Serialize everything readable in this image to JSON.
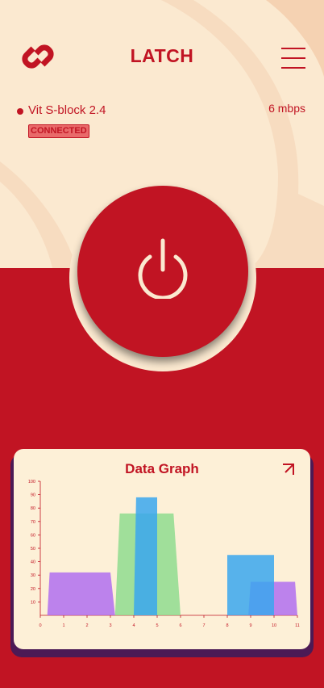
{
  "header": {
    "brand": "LATCH",
    "logo_icon": "chain-link-icon",
    "menu_icon": "hamburger-menu-icon"
  },
  "connection": {
    "network_name": "Vit S-block 2.4",
    "speed": "6 mbps",
    "status": "CONNECTED"
  },
  "power": {
    "icon": "power-icon"
  },
  "graph_card": {
    "title": "Data Graph",
    "expand_icon": "expand-arrow-icon"
  },
  "colors": {
    "primary": "#c11423",
    "cream": "#fbe9d0",
    "purple": "#b06ef0",
    "green": "#8fdc8f",
    "blue": "#3aa7ee"
  },
  "chart_data": {
    "type": "area",
    "xlim": [
      0,
      11
    ],
    "ylim": [
      0,
      100
    ],
    "xticks": [
      "0",
      "1",
      "2",
      "3",
      "4",
      "5",
      "6",
      "7",
      "8",
      "9",
      "10",
      "11"
    ],
    "yticks": [
      "10",
      "20",
      "30",
      "40",
      "50",
      "60",
      "70",
      "80",
      "90",
      "100"
    ],
    "series": [
      {
        "color": "#b06ef0",
        "points": [
          [
            0.3,
            0
          ],
          [
            0.4,
            32
          ],
          [
            3,
            32
          ],
          [
            3.2,
            0
          ]
        ]
      },
      {
        "color": "#b06ef0",
        "points": [
          [
            8.9,
            0
          ],
          [
            9,
            25
          ],
          [
            9.9,
            25
          ],
          [
            10.9,
            25
          ],
          [
            11,
            0
          ]
        ]
      },
      {
        "color": "#8fdc8f",
        "points": [
          [
            3.2,
            0
          ],
          [
            3.4,
            76
          ],
          [
            5.7,
            76
          ],
          [
            6,
            0
          ]
        ]
      },
      {
        "color": "#3aa7ee",
        "points": [
          [
            4,
            0
          ],
          [
            4.1,
            88
          ],
          [
            5,
            88
          ],
          [
            5,
            0
          ]
        ]
      },
      {
        "color": "#3aa7ee",
        "points": [
          [
            8,
            0
          ],
          [
            8,
            45
          ],
          [
            10,
            45
          ],
          [
            10,
            0
          ]
        ]
      }
    ]
  }
}
